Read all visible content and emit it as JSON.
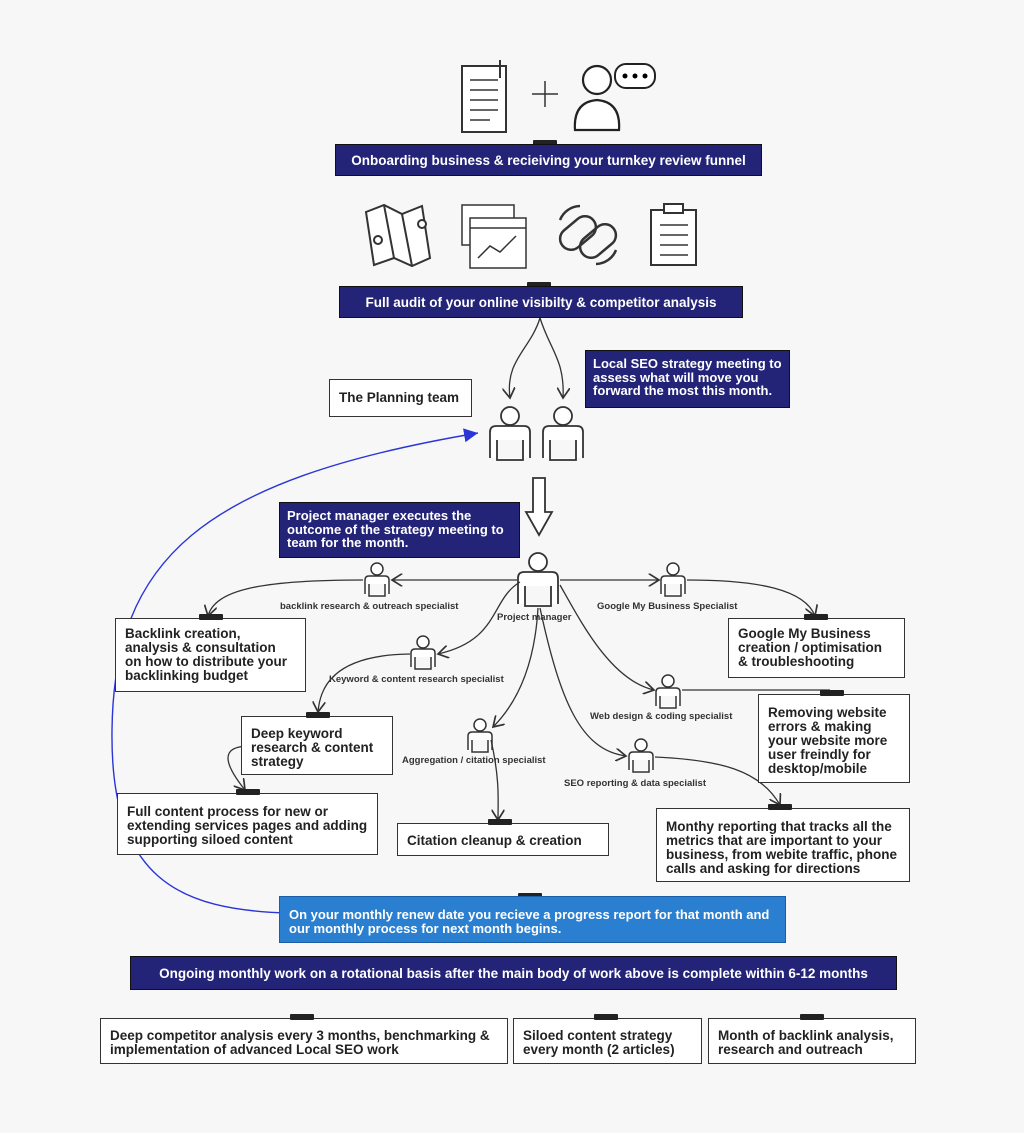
{
  "onboarding_banner": "Onboarding business & recieiving your turnkey review funnel",
  "audit_banner": "Full audit of your online visibilty & competitor analysis",
  "planning_team": "The Planning team",
  "strategy_bubble": "Local SEO strategy meeting to assess what will move you forward the most this month.",
  "pm_bubble": "Project manager executes the outcome of the strategy meeting to team for the month.",
  "project_manager": "Project manager",
  "specialists": {
    "backlink": "backlink research & outreach specialist",
    "gmb": "Google My Business Specialist",
    "keyword": "Keyword & content research specialist",
    "web": "Web design & coding specialist",
    "aggregation": "Aggregation / citation specialist",
    "seo": "SEO reporting & data specialist"
  },
  "tasks": {
    "backlink": "Backlink creation, analysis & consultation on how to distribute your backlinking budget",
    "gmb": "Google My Business creation / optimisation & troubleshooting",
    "keyword": "Deep keyword research & content strategy",
    "web": "Removing website errors & making your website more user freindly for desktop/mobile",
    "content": "Full content process for new or extending services pages and adding supporting siloed content",
    "citation": "Citation cleanup & creation",
    "reporting": "Monthy reporting that tracks all the metrics that are important to your business, from webite traffic, phone calls and asking for directions"
  },
  "renew_note": "On your monthly renew date you recieve a progress report for that month and our monthly process for next month begins.",
  "ongoing_banner": "Ongoing monthly work on a rotational basis after the main body of work above is complete within 6-12 months",
  "ongoing": [
    "Deep competitor analysis every 3 months, benchmarking & implementation of advanced Local SEO work",
    "Siloed content strategy every month (2 articles)",
    "Month of backlink analysis, research and outreach"
  ],
  "colors": {
    "navy": "#232478",
    "blue_note": "#2b7fd0",
    "loop_arrow": "#2a35d8"
  }
}
